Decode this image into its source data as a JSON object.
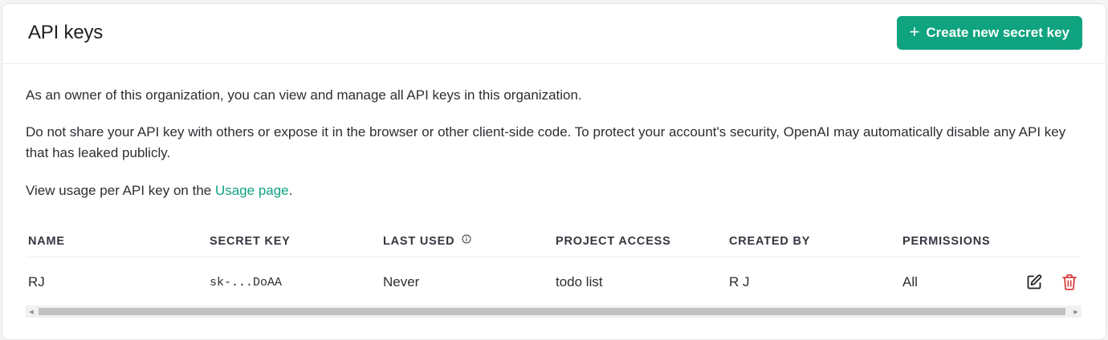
{
  "header": {
    "title": "API keys",
    "create_button": {
      "icon": "plus-icon",
      "label": "Create new secret key"
    }
  },
  "description": {
    "line1": "As an owner of this organization, you can view and manage all API keys in this organization.",
    "line2": "Do not share your API key with others or expose it in the browser or other client-side code. To protect your account's security, OpenAI may automatically disable any API key that has leaked publicly.",
    "line3_prefix": "View usage per API key on the ",
    "line3_link": "Usage page",
    "line3_suffix": "."
  },
  "table": {
    "columns": [
      "NAME",
      "SECRET KEY",
      "LAST USED",
      "PROJECT ACCESS",
      "CREATED BY",
      "PERMISSIONS"
    ],
    "rows": [
      {
        "name": "RJ",
        "secret_key": "sk-...DoAA",
        "last_used": "Never",
        "project_access": "todo list",
        "created_by": "R J",
        "permissions": "All"
      }
    ]
  },
  "colors": {
    "accent": "#10a37f",
    "delete": "#d93c3c"
  }
}
